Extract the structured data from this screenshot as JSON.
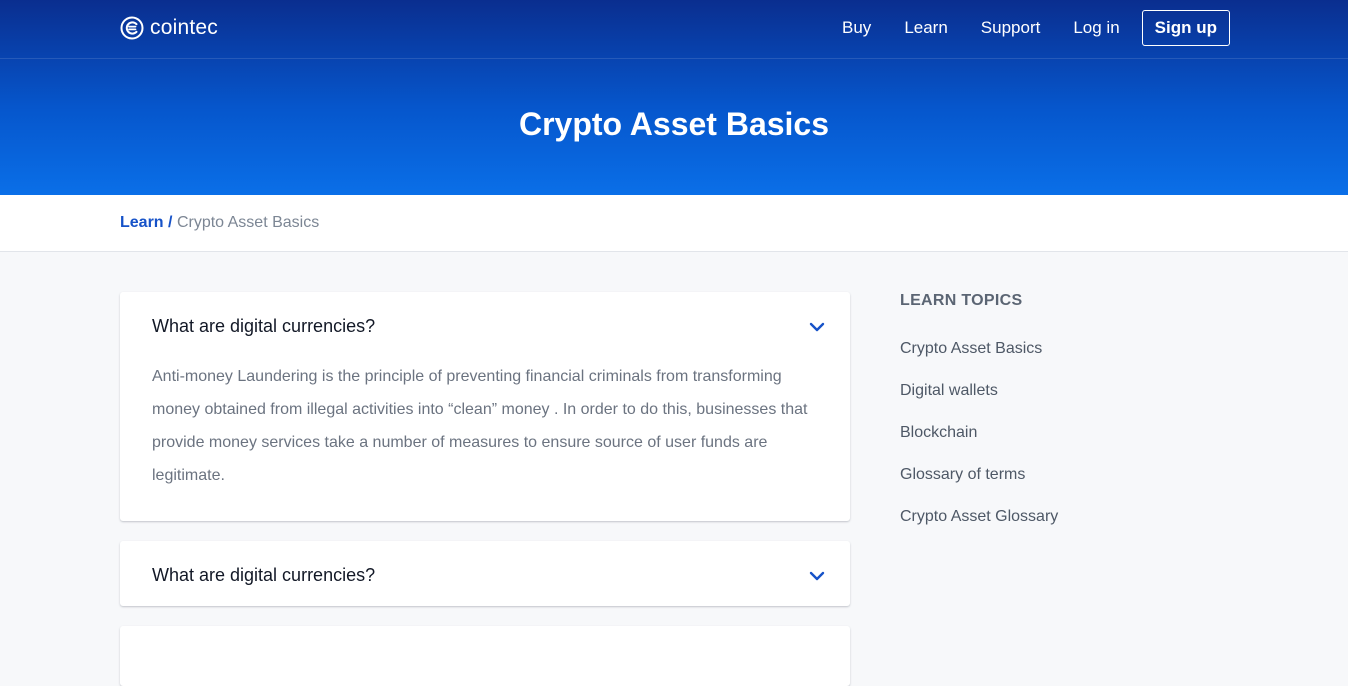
{
  "brand": {
    "name": "cointec"
  },
  "nav": {
    "items": [
      {
        "label": "Buy"
      },
      {
        "label": "Learn"
      },
      {
        "label": "Support"
      },
      {
        "label": "Log in"
      }
    ],
    "signup_label": "Sign up"
  },
  "hero": {
    "title": "Crypto Asset Basics"
  },
  "breadcrumb": {
    "parent": "Learn",
    "separator": "/",
    "current": "Crypto Asset Basics"
  },
  "faq": [
    {
      "question": "What are digital currencies?",
      "answer": "Anti-money Laundering is the principle of preventing financial criminals from transforming money obtained from illegal activities into “clean” money . In order to do this, businesses that provide money services take a number of measures to ensure source of user funds are legitimate.",
      "expanded": true,
      "icon": "chevron-down-icon"
    },
    {
      "question": "What are digital currencies?",
      "expanded": false,
      "icon": "chevron-down-icon"
    }
  ],
  "sidebar": {
    "heading": "LEARN TOPICS",
    "items": [
      {
        "label": "Crypto Asset Basics"
      },
      {
        "label": "Digital wallets"
      },
      {
        "label": "Blockchain"
      },
      {
        "label": "Glossary of terms"
      },
      {
        "label": "Crypto Asset Glossary"
      }
    ]
  },
  "colors": {
    "header_top": "#0a2e8f",
    "header_bottom": "#0a6fe8",
    "accent": "#1652c8",
    "background": "#f7f8fa"
  }
}
